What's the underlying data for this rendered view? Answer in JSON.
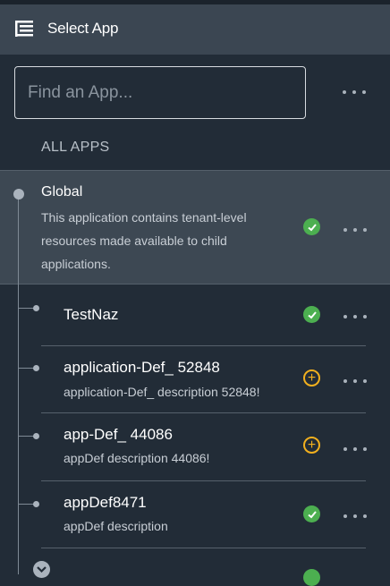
{
  "header": {
    "title": "Select App",
    "menu_icon": "tree-list-icon"
  },
  "search": {
    "placeholder": "Find an App..."
  },
  "section": {
    "label": "ALL APPS"
  },
  "global": {
    "title": "Global",
    "description": "This application contains tenant-level resources made available to child applications.",
    "status": "check-circle-icon"
  },
  "apps": [
    {
      "title": "TestNaz",
      "description": "",
      "status": "check-circle-icon"
    },
    {
      "title": "application-Def_ 52848",
      "description": "application-Def_ description 52848!",
      "status": "plus-circle-icon"
    },
    {
      "title": "app-Def_ 44086",
      "description": "appDef description 44086!",
      "status": "plus-circle-icon"
    },
    {
      "title": "appDef8471",
      "description": "appDef description",
      "status": "check-circle-icon"
    }
  ],
  "colors": {
    "background": "#222c37",
    "header": "#3b4652",
    "selected_row": "#3d4853",
    "check": "#4caf50",
    "plus": "#f2b01e"
  }
}
